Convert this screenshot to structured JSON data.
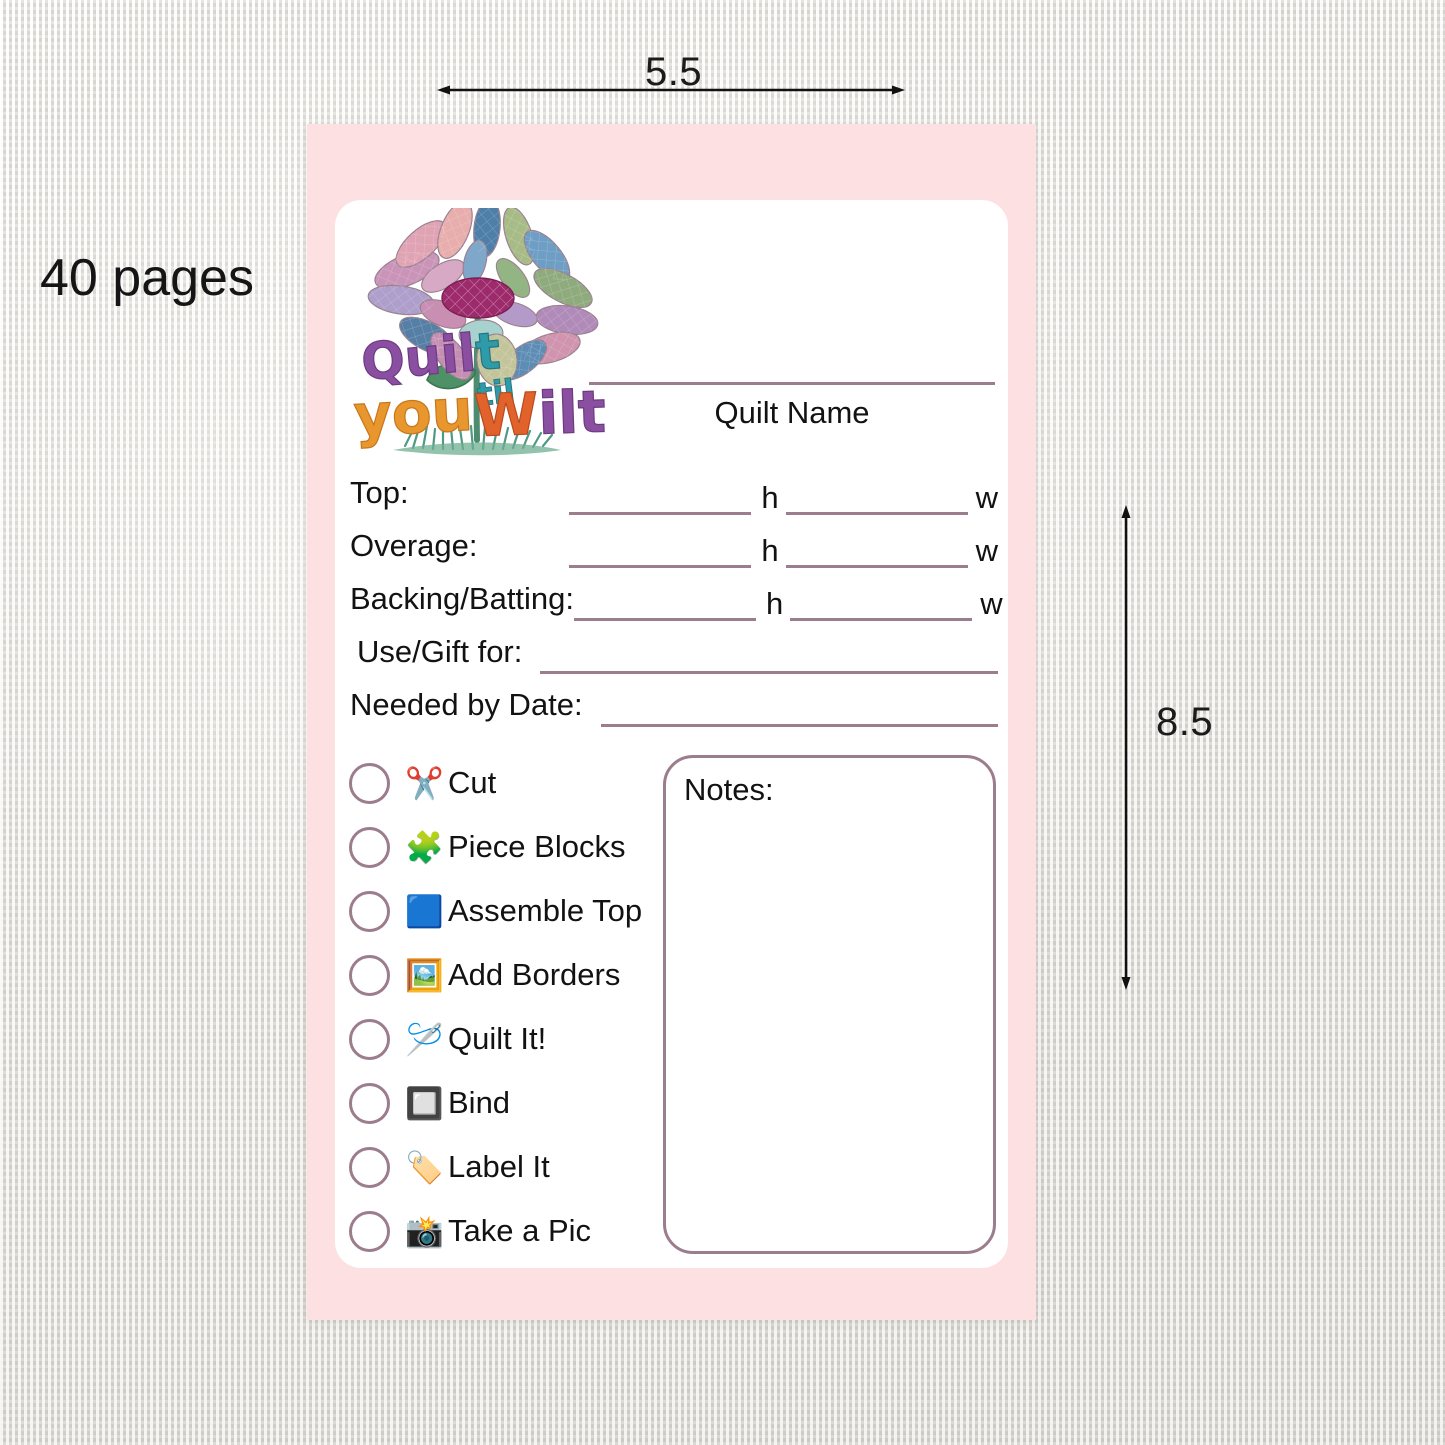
{
  "annotations": {
    "width_dimension": "5.5",
    "height_dimension": "8.5",
    "page_count": "40 pages"
  },
  "card": {
    "logo": {
      "name": "quilt-til-you-wilt-logo",
      "line1": "Quilt",
      "line2": "til",
      "line3": "you",
      "line4": "Wilt"
    },
    "quilt_name_label": "Quilt Name",
    "form_rows": [
      {
        "label": "Top:",
        "type": "hw",
        "unit_h": "h",
        "unit_w": "w"
      },
      {
        "label": "Overage:",
        "type": "hw",
        "unit_h": "h",
        "unit_w": "w"
      },
      {
        "label": "Backing/Batting:",
        "type": "hw",
        "unit_h": "h",
        "unit_w": "w"
      },
      {
        "label": "Use/Gift for:",
        "type": "wide"
      },
      {
        "label": "Needed by Date:",
        "type": "wide"
      }
    ],
    "checklist": [
      {
        "icon": "✂️",
        "icon_name": "scissors-icon",
        "label": "Cut"
      },
      {
        "icon": "🧩",
        "icon_name": "puzzle-piece-icon",
        "label": "Piece Blocks"
      },
      {
        "icon": "🟦",
        "icon_name": "blue-square-icon",
        "label": "Assemble Top"
      },
      {
        "icon": "🖼️",
        "icon_name": "framed-picture-icon",
        "label": "Add Borders"
      },
      {
        "icon": "🪡",
        "icon_name": "sewing-needle-icon",
        "label": "Quilt It!"
      },
      {
        "icon": "🔲",
        "icon_name": "black-square-button-icon",
        "label": "Bind"
      },
      {
        "icon": "🏷️",
        "icon_name": "label-tag-icon",
        "label": "Label It"
      },
      {
        "icon": "📸",
        "icon_name": "camera-flash-icon",
        "label": "Take a Pic"
      }
    ],
    "notes_label": "Notes:"
  },
  "colors": {
    "card_pink": "#fce0e2",
    "rule_mauve": "#9c7d8d",
    "card_white": "#ffffff",
    "background_linen": "#eae8e2",
    "text_black": "#121212"
  }
}
